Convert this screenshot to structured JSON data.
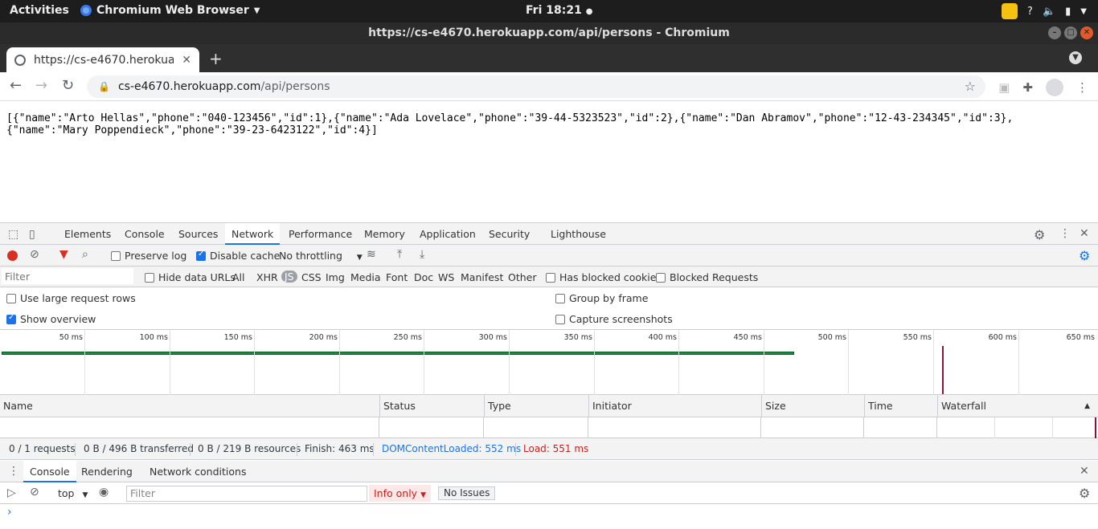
{
  "os": {
    "activities": "Activities",
    "app_name": "Chromium Web Browser",
    "clock": "Fri 18:21"
  },
  "window": {
    "title": "https://cs-e4670.herokuapp.com/api/persons - Chromium"
  },
  "tab": {
    "title": "https://cs-e4670.herokuap"
  },
  "omnibox": {
    "host": "cs-e4670.herokuapp.com",
    "path": "/api/persons"
  },
  "page": {
    "json_text": "[{\"name\":\"Arto Hellas\",\"phone\":\"040-123456\",\"id\":1},{\"name\":\"Ada Lovelace\",\"phone\":\"39-44-5323523\",\"id\":2},{\"name\":\"Dan Abramov\",\"phone\":\"12-43-234345\",\"id\":3},\n{\"name\":\"Mary Poppendieck\",\"phone\":\"39-23-6423122\",\"id\":4}]"
  },
  "devtools": {
    "tabs": [
      "Elements",
      "Console",
      "Sources",
      "Network",
      "Performance",
      "Memory",
      "Application",
      "Security",
      "Lighthouse"
    ],
    "active_tab": "Network",
    "network": {
      "preserve_log": "Preserve log",
      "disable_cache": "Disable cache",
      "throttling": "No throttling",
      "filter_placeholder": "Filter",
      "hide_data_urls": "Hide data URLs",
      "types": [
        "All",
        "XHR",
        "JS",
        "CSS",
        "Img",
        "Media",
        "Font",
        "Doc",
        "WS",
        "Manifest",
        "Other"
      ],
      "has_blocked_cookies": "Has blocked cookies",
      "blocked_requests": "Blocked Requests",
      "large_rows": "Use large request rows",
      "show_overview": "Show overview",
      "group_by_frame": "Group by frame",
      "capture_screenshots": "Capture screenshots",
      "ticks": [
        "50 ms",
        "100 ms",
        "150 ms",
        "200 ms",
        "250 ms",
        "300 ms",
        "350 ms",
        "400 ms",
        "450 ms",
        "500 ms",
        "550 ms",
        "600 ms",
        "650 ms"
      ],
      "columns": [
        "Name",
        "Status",
        "Type",
        "Initiator",
        "Size",
        "Time",
        "Waterfall"
      ],
      "summary": {
        "requests": "0 / 1 requests",
        "transferred": "0 B / 496 B transferred",
        "resources": "0 B / 219 B resources",
        "finish": "Finish: 463 ms",
        "dcl": "DOMContentLoaded: 552 ms",
        "load": "Load: 551 ms"
      }
    },
    "drawer": {
      "tabs": [
        "Console",
        "Rendering",
        "Network conditions"
      ],
      "context": "top",
      "filter_placeholder": "Filter",
      "levels": "Info only",
      "issues": "No Issues",
      "prompt": "›"
    }
  },
  "colors": {
    "accent": "#1a73e8",
    "record": "#d93025",
    "dcl": "#1a73e8",
    "load": "#c5221f"
  }
}
